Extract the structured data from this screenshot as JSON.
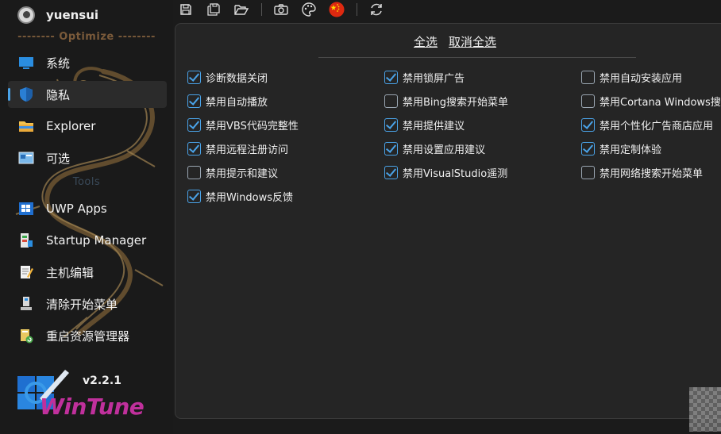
{
  "user": {
    "name": "yuensui"
  },
  "sidebar": {
    "section_optimize": "-------- Optimize --------",
    "section_tools": "Tools",
    "items": [
      {
        "label": "系统",
        "icon": "monitor-icon"
      },
      {
        "label": "隐私",
        "icon": "shield-icon",
        "active": true
      },
      {
        "label": "Explorer",
        "icon": "folder-icon"
      },
      {
        "label": "可选",
        "icon": "window-icon"
      },
      {
        "label": "UWP Apps",
        "icon": "windows-logo-icon"
      },
      {
        "label": "Startup Manager",
        "icon": "startup-icon"
      },
      {
        "label": "主机编辑",
        "icon": "hosts-edit-icon"
      },
      {
        "label": "清除开始菜单",
        "icon": "computer-icon"
      },
      {
        "label": "重启资源管理器",
        "icon": "restart-folder-icon"
      }
    ]
  },
  "app": {
    "version": "v2.2.1",
    "brand": "WinTune"
  },
  "toolbar": {
    "buttons": [
      "save-icon",
      "save-all-icon",
      "open-folder-icon",
      "camera-icon",
      "palette-icon",
      "china-flag-icon",
      "refresh-icon"
    ]
  },
  "main": {
    "select_all": "全选",
    "deselect_all": "取消全选",
    "options": [
      {
        "label": "诊断数据关闭",
        "checked": true
      },
      {
        "label": "禁用锁屏广告",
        "checked": true
      },
      {
        "label": "禁用自动安装应用",
        "checked": false
      },
      {
        "label": "禁用自动播放",
        "checked": true
      },
      {
        "label": "禁用Bing搜索开始菜单",
        "checked": false
      },
      {
        "label": "禁用Cortana Windows搜索",
        "checked": false
      },
      {
        "label": "禁用VBS代码完整性",
        "checked": true
      },
      {
        "label": "禁用提供建议",
        "checked": true
      },
      {
        "label": "禁用个性化广告商店应用",
        "checked": true
      },
      {
        "label": "禁用远程注册访问",
        "checked": true
      },
      {
        "label": "禁用设置应用建议",
        "checked": true
      },
      {
        "label": "禁用定制体验",
        "checked": true
      },
      {
        "label": "禁用提示和建议",
        "checked": false
      },
      {
        "label": "禁用VisualStudio遥测",
        "checked": true
      },
      {
        "label": "禁用网络搜索开始菜单",
        "checked": false
      },
      {
        "label": "禁用Windows反馈",
        "checked": true
      }
    ]
  },
  "colors": {
    "accent": "#4aa3e8",
    "brand": "#c0309c",
    "panel": "#252525",
    "background": "#1b1b1b"
  }
}
